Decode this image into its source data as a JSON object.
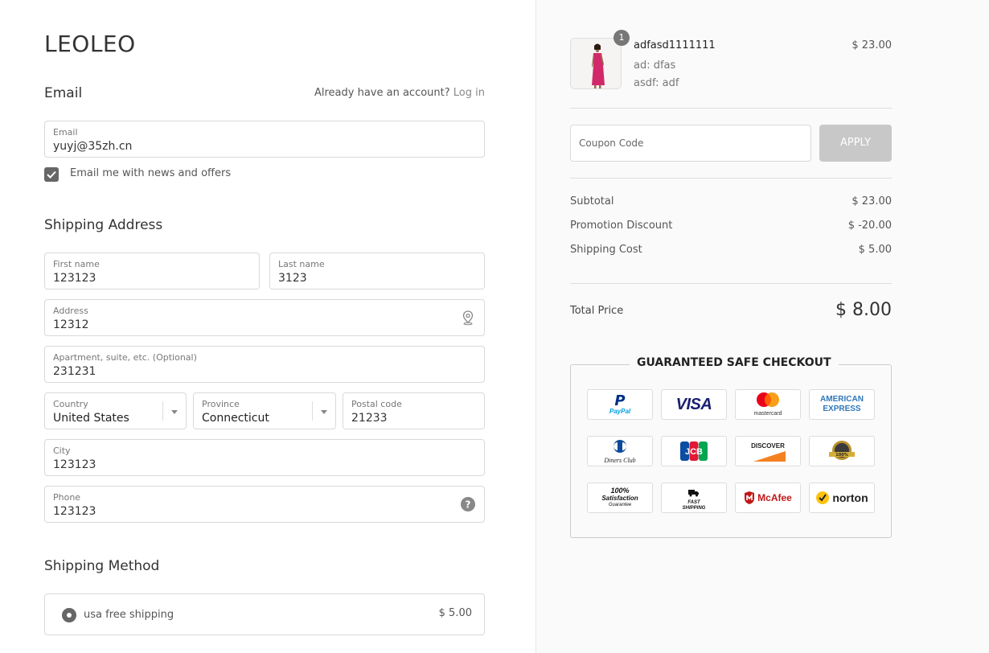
{
  "brand": {
    "logo": "LEOLEO"
  },
  "email_section": {
    "title": "Email",
    "account_prompt": "Already have an account?",
    "login_link": "Log in",
    "email_label": "Email",
    "email_value": "yuyj@35zh.cn",
    "newsletter_label": "Email me with news and offers",
    "newsletter_checked": true
  },
  "shipping_address": {
    "title": "Shipping Address",
    "first_name": {
      "label": "First name",
      "value": "123123"
    },
    "last_name": {
      "label": "Last name",
      "value": "3123"
    },
    "address": {
      "label": "Address",
      "value": "12312",
      "icon": "map-pin-icon"
    },
    "apartment": {
      "label": "Apartment, suite, etc. (Optional)",
      "value": "231231"
    },
    "country": {
      "label": "Country",
      "value": "United States"
    },
    "province": {
      "label": "Province",
      "value": "Connecticut"
    },
    "postal_code": {
      "label": "Postal code",
      "value": "21233"
    },
    "city": {
      "label": "City",
      "value": "123123"
    },
    "phone": {
      "label": "Phone",
      "value": "123123",
      "icon": "help-icon"
    }
  },
  "shipping_method": {
    "title": "Shipping Method",
    "options": [
      {
        "name": "usa free shipping",
        "price": "$ 5.00",
        "selected": true
      }
    ]
  },
  "order_summary": {
    "item": {
      "quantity": "1",
      "name": "adfasd1111111",
      "variant_1": "ad: dfas",
      "variant_2": "asdf: adf",
      "price": "$ 23.00"
    },
    "coupon": {
      "placeholder": "Coupon Code",
      "apply_label": "APPLY"
    },
    "subtotal_label": "Subtotal",
    "subtotal_value": "$ 23.00",
    "discount_label": "Promotion Discount",
    "discount_value": "$ -20.00",
    "shipping_label": "Shipping Cost",
    "shipping_value": "$ 5.00",
    "total_label": "Total Price",
    "total_value": "$ 8.00"
  },
  "trust": {
    "title": "GUARANTEED SAFE CHECKOUT",
    "badges": {
      "paypal": "PayPal",
      "visa": "VISA",
      "mastercard": "mastercard",
      "amex_1": "AMERICAN",
      "amex_2": "EXPRESS",
      "diners": "Diners Club",
      "jcb": "JCB",
      "discover": "DISCOVER",
      "gold_seal": "100%",
      "satisfaction_1": "100%",
      "satisfaction_2": "Satisfaction",
      "satisfaction_3": "Guarantee",
      "fast_1": "FAST",
      "fast_2": "SHIPPING",
      "mcafee": "McAfee",
      "norton": "norton"
    }
  },
  "colors": {
    "panel_bg": "#fafafa",
    "apply_bg": "#c8c8c8",
    "paypal_blue": "#003087",
    "paypal_light": "#009cde",
    "visa_blue": "#1a1f71",
    "amex_blue": "#2e77bb",
    "mc_red": "#eb001b",
    "mc_yellow": "#f79e1b",
    "discover_orange": "#f48120",
    "mcafee_red": "#c01818",
    "norton_yellow": "#ffc20e"
  }
}
